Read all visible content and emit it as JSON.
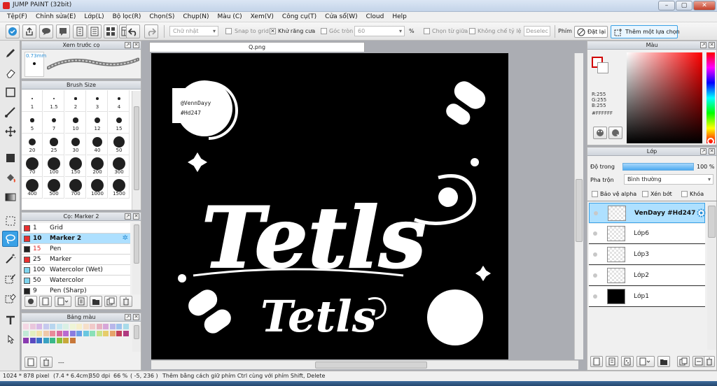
{
  "window": {
    "title": "JUMP PAINT (32bit)",
    "controls": [
      "–",
      "▢",
      "✕"
    ]
  },
  "menu": [
    "Tệp(F)",
    "Chỉnh sửa(E)",
    "Lớp(L)",
    "Bộ lọc(R)",
    "Chọn(S)",
    "Chụp(N)",
    "Màu (C)",
    "Xem(V)",
    "Công cụ(T)",
    "Cửa sổ(W)",
    "Cloud",
    "Help"
  ],
  "toolbar": {
    "shape_select": "Chữ nhật",
    "snap_to_grid": "Snap to grid",
    "antialias": "Khử răng cưa",
    "corner": "Góc tròn",
    "corner_value": "60",
    "percent": "%",
    "select_from_center": "Chọn từ giữa",
    "lock_ratio": "Không chế tỷ lệ",
    "deselect": "Deselec",
    "key_label": "Phím",
    "reset_label": "Đặt lại",
    "add_selection_label": "Thêm một lựa chọn"
  },
  "brush_preview": {
    "title": "Xem trước cọ",
    "size": "0.73mm"
  },
  "brush_size": {
    "title": "Brush Size",
    "sizes": [
      "1",
      "1.5",
      "2",
      "3",
      "4",
      "5",
      "7",
      "10",
      "12",
      "15",
      "20",
      "25",
      "30",
      "40",
      "50",
      "70",
      "100",
      "150",
      "200",
      "300",
      "400",
      "500",
      "700",
      "1000",
      "1500"
    ]
  },
  "brush_list": {
    "title": "Cọ: Marker 2",
    "items": [
      {
        "num": "1",
        "name": "Grid",
        "color": "#e83030"
      },
      {
        "num": "10",
        "name": "Marker 2",
        "color": "#e83030",
        "selected": true
      },
      {
        "num": "15",
        "name": "Pen",
        "color": "#222222"
      },
      {
        "num": "25",
        "name": "Marker",
        "color": "#e83030"
      },
      {
        "num": "100",
        "name": "Watercolor (Wet)",
        "color": "#7fd4ee"
      },
      {
        "num": "50",
        "name": "Watercolor",
        "color": "#7fd4ee"
      },
      {
        "num": "9",
        "name": "Pen (Sharp)",
        "color": "#222222"
      }
    ]
  },
  "palette": {
    "title": "Bảng màu",
    "footer": "---"
  },
  "document": {
    "tab": "Q.png",
    "credit_line1": "@VennDayy",
    "credit_line2": "#Hd247",
    "big_text": "Tetls",
    "small_text": "Tetls"
  },
  "color_panel": {
    "title": "Màu",
    "r": "R:255",
    "g": "G:255",
    "b": "B:255",
    "hex": "#FFFFFF"
  },
  "layers": {
    "title": "Lớp",
    "opacity_label": "Độ trong",
    "opacity_value": "100 %",
    "opacity_fraction": 1.0,
    "blend_label": "Pha trộn",
    "blend_value": "Bình thường",
    "protect_alpha": "Bảo vệ alpha",
    "clip": "Xén bớt",
    "lock": "Khóa",
    "items": [
      "VenDayy #Hd247",
      "Lớp6",
      "Lớp3",
      "Lớp2",
      "Lớp1"
    ]
  },
  "status": {
    "size": "1024 * 878 pixel",
    "physical": "(7.4 * 6.4cm)",
    "dpi": "350 dpi",
    "zoom": "66 %",
    "coords": "( -5, 236 )",
    "hint": "Thêm bằng cách giữ phím Ctrl cùng với phím Shift, Delete"
  },
  "colors": {
    "accent": "#3aa1e6",
    "selected_row": "#aee0ff"
  }
}
